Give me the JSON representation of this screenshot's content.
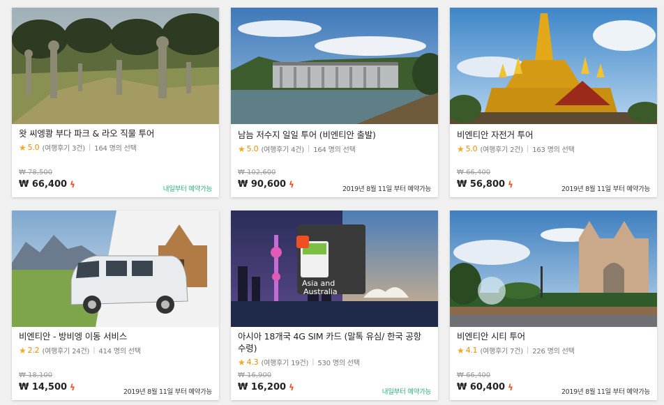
{
  "colors": {
    "accent": "#f04e23",
    "star": "#f5a623",
    "available_now": "#2bb673"
  },
  "products": [
    {
      "title": "왓 씨엥쾅 부다 파크 & 라오 직물 투어",
      "rating": "5.0",
      "reviews": "(여행후기 3건)",
      "selected": "164 명의 선택",
      "original_price": "₩ 78,500",
      "price": "₩ 66,400",
      "availability": "내일부터 예약가능",
      "availability_style": "green",
      "image_icon": "buddha-park-photo"
    },
    {
      "title": "남늠 저수지 일일 투어 (비엔티안 출발)",
      "rating": "5.0",
      "reviews": "(여행후기 4건)",
      "selected": "164 명의 선택",
      "original_price": "₩ 102,600",
      "price": "₩ 90,600",
      "availability": "2019년 8월 11일 부터 예약가능",
      "availability_style": "normal",
      "image_icon": "dam-reservoir-photo"
    },
    {
      "title": "비엔티안 자전거 투어",
      "rating": "5.0",
      "reviews": "(여행후기 2건)",
      "selected": "163 명의 선택",
      "original_price": "₩ 66,400",
      "price": "₩ 56,800",
      "availability": "2019년 8월 11일 부터 예약가능",
      "availability_style": "normal",
      "image_icon": "golden-stupa-photo"
    },
    {
      "title": "비엔티안 - 방비엥 이동 서비스",
      "rating": "2.2",
      "reviews": "(여행후기 24건)",
      "selected": "414 명의 선택",
      "original_price": "₩ 18,100",
      "price": "₩ 14,500",
      "availability": "2019년 8월 11일 부터 예약가능",
      "availability_style": "normal",
      "image_icon": "van-transfer-photo"
    },
    {
      "title": "아시아 18개국 4G SIM 카드 (말톡 유심/ 한국 공항 수령)",
      "rating": "4.3",
      "reviews": "(여행후기 19건)",
      "selected": "530 명의 선택",
      "original_price": "₩ 16,900",
      "price": "₩ 16,200",
      "availability": "내일부터 예약가능",
      "availability_style": "green",
      "image_icon": "sim-card-photo",
      "sim_text_1": "Asia and",
      "sim_text_2": "Australia"
    },
    {
      "title": "비엔티안 시티 투어",
      "rating": "4.1",
      "reviews": "(여행후기 7건)",
      "selected": "226 명의 선택",
      "original_price": "₩ 66,400",
      "price": "₩ 60,400",
      "availability": "2019년 8월 11일 부터 예약가능",
      "availability_style": "normal",
      "image_icon": "patuxai-monument-photo"
    }
  ]
}
